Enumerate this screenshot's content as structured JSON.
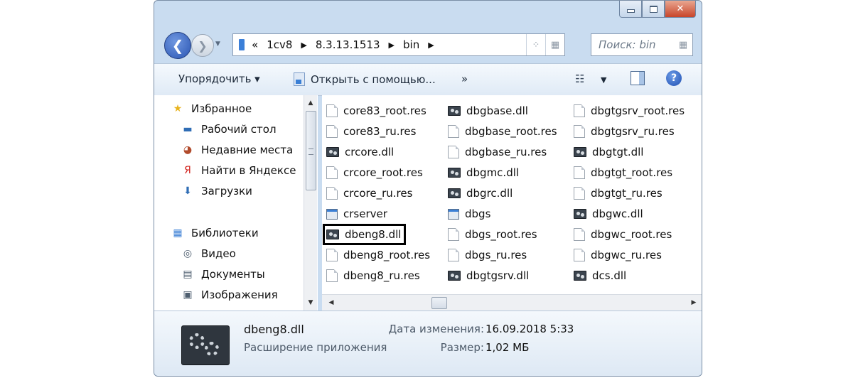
{
  "window": {
    "controls": {
      "minimize_icon": "minimize-icon",
      "maximize_icon": "maximize-icon",
      "close_icon": "close-icon",
      "close_glyph": "✕"
    }
  },
  "nav_buttons": {
    "back_glyph": "❮",
    "forward_glyph": "❯",
    "dropdown_glyph": "▼"
  },
  "address": {
    "chevron_start": "«",
    "segments": [
      "1cv8",
      "8.3.13.1513",
      "bin"
    ],
    "separator": "▶",
    "refresh_glyph": "⁘",
    "view_glyph": "▦"
  },
  "search": {
    "placeholder": "Поиск: bin",
    "icon_glyph": "▦"
  },
  "toolbar": {
    "organize_label": "Упорядочить ▾",
    "open_with_label": "Открыть с помощью...",
    "more_label": "»",
    "views_glyph": "☷",
    "views_drop": "▼",
    "help_glyph": "?"
  },
  "nav_pane": {
    "items": [
      {
        "label": "Избранное",
        "icon": "star-icon",
        "glyph": "★",
        "color": "#e8b31c"
      },
      {
        "label": "Рабочий стол",
        "icon": "desktop-icon",
        "glyph": "▬",
        "color": "#2f6db5"
      },
      {
        "label": "Недавние места",
        "icon": "recent-places-icon",
        "glyph": "◕",
        "color": "#b14b2c"
      },
      {
        "label": "Найти в Яндексе",
        "icon": "yandex-icon",
        "glyph": "Я",
        "color": "#d2231e"
      },
      {
        "label": "Загрузки",
        "icon": "downloads-icon",
        "glyph": "⬇",
        "color": "#2f6db5"
      },
      {
        "label": "Библиотеки",
        "icon": "libraries-icon",
        "glyph": "▦",
        "color": "#3a7fd5"
      },
      {
        "label": "Видео",
        "icon": "video-icon",
        "glyph": "◎",
        "color": "#4f5f70"
      },
      {
        "label": "Документы",
        "icon": "documents-icon",
        "glyph": "▤",
        "color": "#4f5f70"
      },
      {
        "label": "Изображения",
        "icon": "images-icon",
        "glyph": "▣",
        "color": "#4f5f70"
      }
    ],
    "scroll_up": "▲",
    "scroll_down": "▼"
  },
  "files": {
    "columns": [
      [
        {
          "name": "core83_root.res",
          "type": "res"
        },
        {
          "name": "core83_ru.res",
          "type": "res"
        },
        {
          "name": "crcore.dll",
          "type": "dll"
        },
        {
          "name": "crcore_root.res",
          "type": "res"
        },
        {
          "name": "crcore_ru.res",
          "type": "res"
        },
        {
          "name": "crserver",
          "type": "exe"
        },
        {
          "name": "dbeng8.dll",
          "type": "dll",
          "selected": true
        },
        {
          "name": "dbeng8_root.res",
          "type": "res"
        },
        {
          "name": "dbeng8_ru.res",
          "type": "res"
        }
      ],
      [
        {
          "name": "dbgbase.dll",
          "type": "dll"
        },
        {
          "name": "dbgbase_root.res",
          "type": "res"
        },
        {
          "name": "dbgbase_ru.res",
          "type": "res"
        },
        {
          "name": "dbgmc.dll",
          "type": "dll"
        },
        {
          "name": "dbgrc.dll",
          "type": "dll"
        },
        {
          "name": "dbgs",
          "type": "exe"
        },
        {
          "name": "dbgs_root.res",
          "type": "res"
        },
        {
          "name": "dbgs_ru.res",
          "type": "res"
        },
        {
          "name": "dbgtgsrv.dll",
          "type": "dll"
        }
      ],
      [
        {
          "name": "dbgtgsrv_root.res",
          "type": "res"
        },
        {
          "name": "dbgtgsrv_ru.res",
          "type": "res"
        },
        {
          "name": "dbgtgt.dll",
          "type": "dll"
        },
        {
          "name": "dbgtgt_root.res",
          "type": "res"
        },
        {
          "name": "dbgtgt_ru.res",
          "type": "res"
        },
        {
          "name": "dbgwc.dll",
          "type": "dll"
        },
        {
          "name": "dbgwc_root.res",
          "type": "res"
        },
        {
          "name": "dbgwc_ru.res",
          "type": "res"
        },
        {
          "name": "dcs.dll",
          "type": "dll"
        }
      ]
    ],
    "hscroll_left": "◀",
    "hscroll_right": "▶"
  },
  "details": {
    "file_name": "dbeng8.dll",
    "file_type": "Расширение приложения",
    "modified_label": "Дата изменения:",
    "modified_value": "16.09.2018 5:33",
    "size_label": "Размер:",
    "size_value": "1,02 МБ"
  }
}
